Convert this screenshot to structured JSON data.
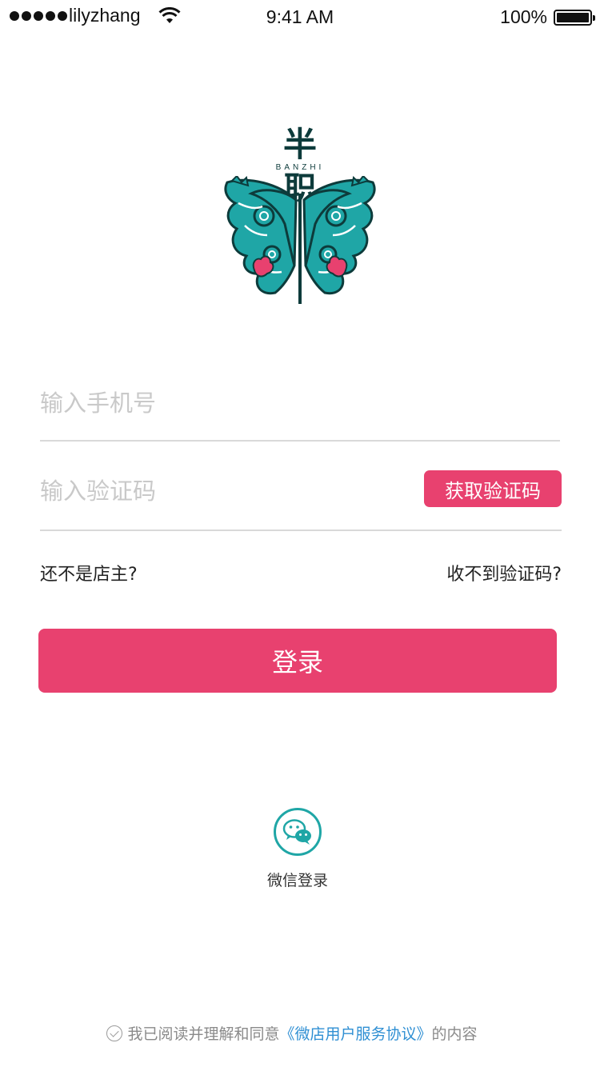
{
  "status_bar": {
    "carrier": "lilyzhang",
    "time": "9:41 AM",
    "battery": "100%"
  },
  "logo": {
    "char1": "半",
    "sub": "BANZHI",
    "char2": "职"
  },
  "form": {
    "phone_placeholder": "输入手机号",
    "code_placeholder": "输入验证码",
    "get_code_label": "获取验证码",
    "not_owner_link": "还不是店主?",
    "no_code_link": "收不到验证码?",
    "login_label": "登录"
  },
  "wechat": {
    "label": "微信登录"
  },
  "agreement": {
    "prefix": "我已阅读并理解和同意",
    "link": "《微店用户服务协议》",
    "suffix": "的内容"
  },
  "colors": {
    "accent": "#e8416f",
    "teal": "#1fa6a6",
    "link": "#2f8fd3"
  }
}
